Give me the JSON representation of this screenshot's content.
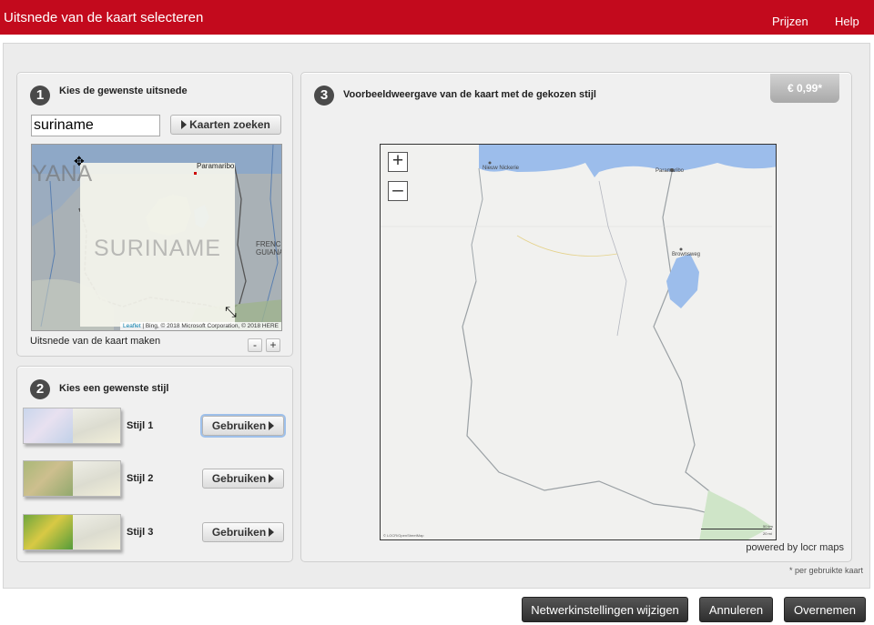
{
  "header": {
    "title": "Uitsnede van de kaart selecteren",
    "nav": [
      "Prijzen",
      "Help"
    ]
  },
  "step1": {
    "number": "1",
    "title": "Kies de gewenste uitsnede",
    "search_value": "suriname",
    "search_button": "Kaarten zoeken",
    "map": {
      "country_label": "SURINAME",
      "neighbor_left": "YANA",
      "neighbor_right": "FRENCH GUIANA",
      "city": "Paramaribo",
      "attribution_leaflet": "Leaflet",
      "attribution_rest": " | Bing, © 2018 Microsoft Corporation, © 2018 HERE"
    },
    "cutout_label": "Uitsnede van de kaart maken",
    "zoom_out": "-",
    "zoom_in": "+"
  },
  "step2": {
    "number": "2",
    "title": "Kies een gewenste stijl",
    "styles": [
      {
        "label": "Stijl 1",
        "button": "Gebruiken",
        "active": true
      },
      {
        "label": "Stijl 2",
        "button": "Gebruiken",
        "active": false
      },
      {
        "label": "Stijl 3",
        "button": "Gebruiken",
        "active": false
      }
    ]
  },
  "step3": {
    "number": "3",
    "title": "Voorbeeldweergave van de kaart met de gekozen stijl",
    "price": "€ 0,99*",
    "zoom_in": "+",
    "zoom_out": "–",
    "cities": [
      "Nieuw Nickerie",
      "Paramaribo",
      "Brownsweg"
    ],
    "credit": "© LOCR/OpenStreetMap",
    "scale_metric": "50 km",
    "scale_imperial": "20 mi",
    "powered_by": "powered by locr maps"
  },
  "footnote": "* per gebruikte kaart",
  "footer_buttons": {
    "network": "Netwerkinstellingen wijzigen",
    "cancel": "Annuleren",
    "accept": "Overnemen"
  },
  "colors": {
    "brand_red": "#c30a1d",
    "dark_button": "#3a3a3a",
    "water": "#8ea8c7"
  }
}
